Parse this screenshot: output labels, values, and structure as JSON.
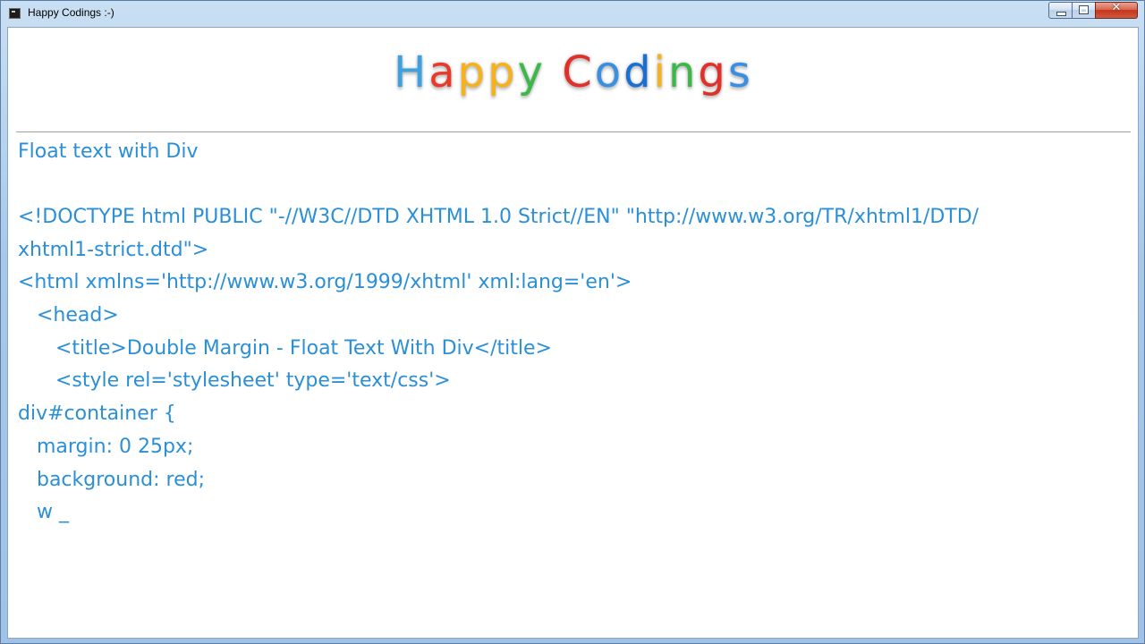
{
  "window": {
    "title": "Happy Codings :-)",
    "controls": {
      "close_glyph": "✕"
    }
  },
  "logo": {
    "letters": [
      {
        "ch": "H",
        "color": "#3fa0e0"
      },
      {
        "ch": "a",
        "color": "#e83a2a"
      },
      {
        "ch": "p",
        "color": "#f5b21a"
      },
      {
        "ch": "p",
        "color": "#f5b21a"
      },
      {
        "ch": "y",
        "color": "#3cb84a"
      },
      {
        "ch": " ",
        "color": "#ffffff"
      },
      {
        "ch": "C",
        "color": "#e0302a"
      },
      {
        "ch": "o",
        "color": "#3a8fe0"
      },
      {
        "ch": "d",
        "color": "#1a6fd0"
      },
      {
        "ch": "i",
        "color": "#f5b21a"
      },
      {
        "ch": "n",
        "color": "#3cb84a"
      },
      {
        "ch": "g",
        "color": "#e0302a"
      },
      {
        "ch": "s",
        "color": "#3a8fe0"
      }
    ]
  },
  "content": {
    "title": "Float text with Div",
    "text_color": "#2b8fd6",
    "code_lines": [
      "<!DOCTYPE html PUBLIC \"-//W3C//DTD XHTML 1.0 Strict//EN\" \"http://www.w3.org/TR/xhtml1/DTD/",
      "xhtml1-strict.dtd\">",
      "<html xmlns='http://www.w3.org/1999/xhtml' xml:lang='en'>",
      "   <head>",
      "      <title>Double Margin - Float Text With Div</title>",
      "      <style rel='stylesheet' type='text/css'>",
      "div#container {",
      "   margin: 0 25px;",
      "   background: red;",
      "   w _"
    ]
  }
}
